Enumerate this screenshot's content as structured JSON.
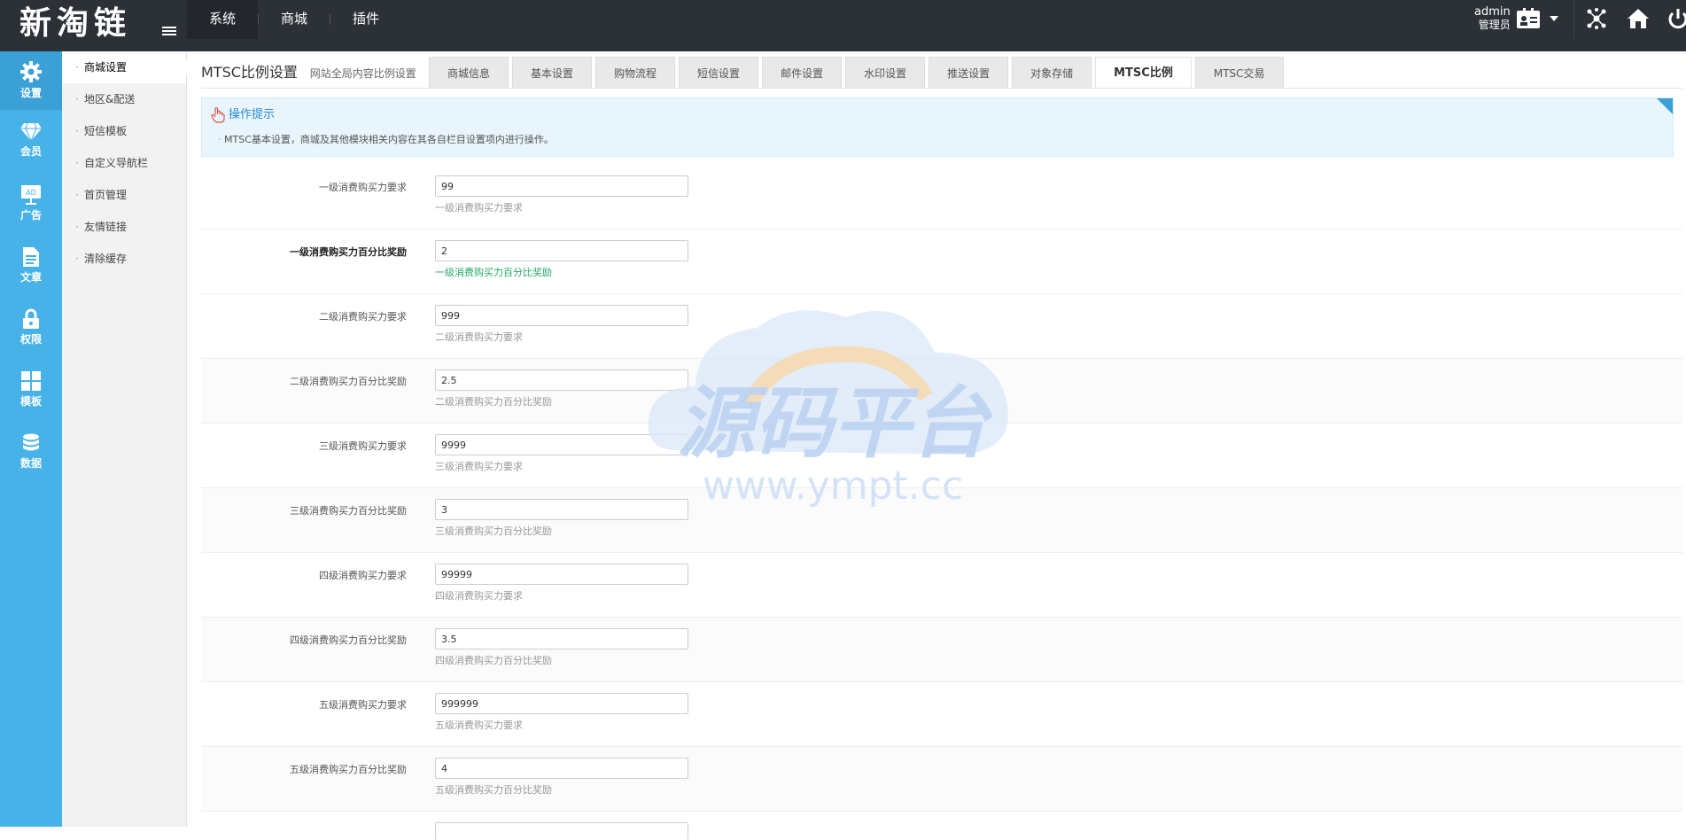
{
  "app": {
    "logo": "新淘链"
  },
  "topnav": {
    "items": [
      {
        "label": "系统",
        "active": true
      },
      {
        "label": "商城",
        "active": false
      },
      {
        "label": "插件",
        "active": false
      }
    ]
  },
  "user": {
    "name": "admin",
    "role": "管理员"
  },
  "iconbar": {
    "items": [
      {
        "label": "设置",
        "icon": "gear-icon"
      },
      {
        "label": "会员",
        "icon": "gem-icon"
      },
      {
        "label": "广告",
        "icon": "ad-icon"
      },
      {
        "label": "文章",
        "icon": "document-icon"
      },
      {
        "label": "权限",
        "icon": "lock-icon"
      },
      {
        "label": "模板",
        "icon": "grid-icon"
      },
      {
        "label": "数据",
        "icon": "database-icon"
      }
    ]
  },
  "submenu": {
    "items": [
      {
        "label": "商城设置"
      },
      {
        "label": "地区&配送"
      },
      {
        "label": "短信模板"
      },
      {
        "label": "自定义导航栏"
      },
      {
        "label": "首页管理"
      },
      {
        "label": "友情链接"
      },
      {
        "label": "清除缓存"
      }
    ]
  },
  "page": {
    "title": "MTSC比例设置",
    "subtitle": "网站全局内容比例设置"
  },
  "tabs": [
    {
      "label": "商城信息"
    },
    {
      "label": "基本设置"
    },
    {
      "label": "购物流程"
    },
    {
      "label": "短信设置"
    },
    {
      "label": "邮件设置"
    },
    {
      "label": "水印设置"
    },
    {
      "label": "推送设置"
    },
    {
      "label": "对象存储"
    },
    {
      "label": "MTSC比例"
    },
    {
      "label": "MTSC交易"
    }
  ],
  "tips": {
    "title": "操作提示",
    "body": "MTSC基本设置，商城及其他模块相关内容在其各自栏目设置项内进行操作。"
  },
  "form": {
    "rows": [
      {
        "label": "一级消费购买力要求",
        "value": "99",
        "hint": "一级消费购买力要求"
      },
      {
        "label": "一级消费购买力百分比奖励",
        "value": "2",
        "hint": "一级消费购买力百分比奖励"
      },
      {
        "label": "二级消费购买力要求",
        "value": "999",
        "hint": "二级消费购买力要求"
      },
      {
        "label": "二级消费购买力百分比奖励",
        "value": "2.5",
        "hint": "二级消费购买力百分比奖励"
      },
      {
        "label": "三级消费购买力要求",
        "value": "9999",
        "hint": "三级消费购买力要求"
      },
      {
        "label": "三级消费购买力百分比奖励",
        "value": "3",
        "hint": "三级消费购买力百分比奖励"
      },
      {
        "label": "四级消费购买力要求",
        "value": "99999",
        "hint": "四级消费购买力要求"
      },
      {
        "label": "四级消费购买力百分比奖励",
        "value": "3.5",
        "hint": "四级消费购买力百分比奖励"
      },
      {
        "label": "五级消费购买力要求",
        "value": "999999",
        "hint": "五级消费购买力要求"
      },
      {
        "label": "五级消费购买力百分比奖励",
        "value": "4",
        "hint": "五级消费购买力百分比奖励"
      }
    ]
  },
  "watermark": {
    "text": "源码平台",
    "url": "www.ympt.cc"
  },
  "colors": {
    "topbar": "#2c3138",
    "sidebar": "#47b2e8",
    "tips_bg": "#e8f5fc",
    "hint_active": "#26a96a"
  }
}
